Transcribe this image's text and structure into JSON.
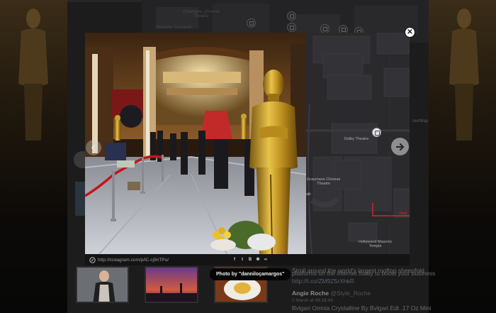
{
  "photo": {
    "url": "http://instagram.com/p/lC-cj9nTPo/",
    "credit": "Photo by \"danniloçamargos\""
  },
  "map": {
    "labels": {
      "dolby": "Dolby Theatre",
      "graumans": "Graumans Chinese\nTheatre",
      "masonic": "Hollywood Masonic\nTemple",
      "elcapitan": "El Capitan Theatre",
      "walk": "alk",
      "red": "Red"
    },
    "route_color": "#d0282b"
  },
  "background": {
    "map_labels": {
      "graumans": "Graumans Chinese\nTheatre",
      "madame": "Madame Tussauds",
      "streetmap": "reetMap"
    },
    "feed": {
      "line1": "Stroll around the world's largest rooftop sheepfold",
      "line2": "platforms on the internet today to boost your business",
      "link": "http://t.co/ZM9Z5rXhkR",
      "author": "Angie Roche",
      "handle": "@Style_Roche",
      "time": "2 March at 08:18:43",
      "text": "Bvlgari Omnia Crystalline By Bvlgari Edt .17 Oz Mini"
    }
  },
  "colors": {
    "close_bg": "#ffffff",
    "next_bg": "#8e8e8e",
    "map_bg": "#2a2a2d"
  },
  "icons": [
    "close-icon",
    "arrow-right-icon",
    "arrow-left-icon",
    "link-icon",
    "facebook-icon",
    "twitter-icon",
    "tumblr-icon",
    "vk-icon",
    "share-icon",
    "camera-pin-icon"
  ]
}
